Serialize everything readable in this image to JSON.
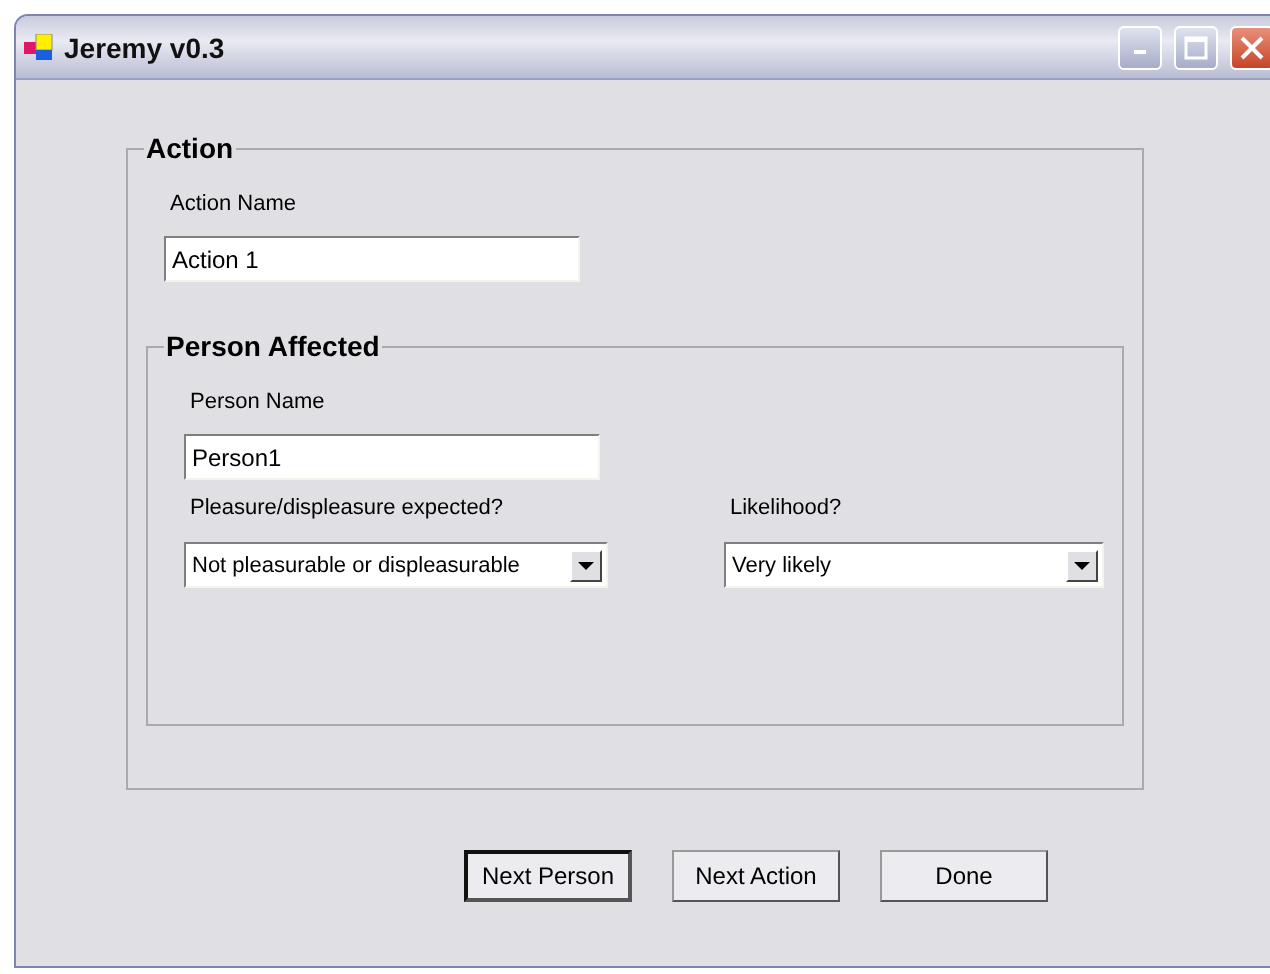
{
  "window": {
    "title": "Jeremy v0.3"
  },
  "action_group": {
    "title": "Action",
    "name_label": "Action Name",
    "name_value": "Action 1"
  },
  "person_group": {
    "title": "Person Affected",
    "name_label": "Person Name",
    "name_value": "Person1",
    "pleasure_label": "Pleasure/displeasure expected?",
    "pleasure_value": "Not pleasurable or displeasurable",
    "likelihood_label": "Likelihood?",
    "likelihood_value": "Very likely"
  },
  "buttons": [
    {
      "label": "Next Person",
      "default": true
    },
    {
      "label": "Next Action",
      "default": false
    },
    {
      "label": "Done",
      "default": false
    }
  ]
}
